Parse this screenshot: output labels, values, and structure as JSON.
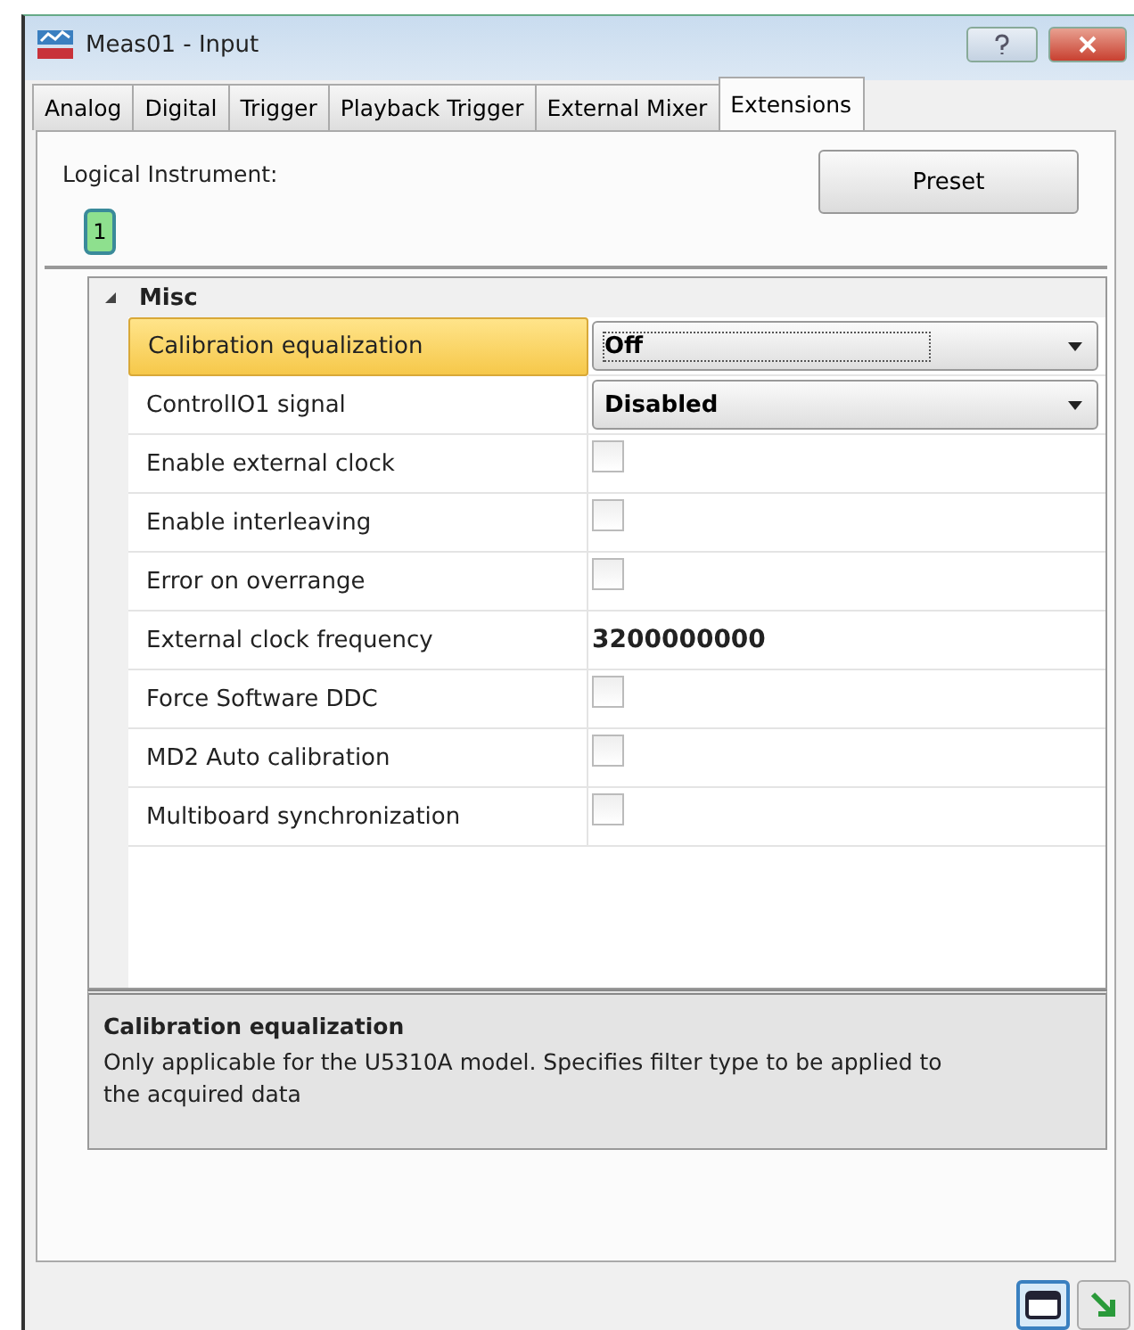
{
  "window": {
    "title": "Meas01 - Input"
  },
  "tabs": [
    {
      "label": "Analog",
      "selected": false
    },
    {
      "label": "Digital",
      "selected": false
    },
    {
      "label": "Trigger",
      "selected": false
    },
    {
      "label": "Playback Trigger",
      "selected": false
    },
    {
      "label": "External Mixer",
      "selected": false
    },
    {
      "label": "Extensions",
      "selected": true
    }
  ],
  "logical_instrument": {
    "label": "Logical Instrument:",
    "instruments": [
      {
        "label": "1",
        "selected": true
      }
    ]
  },
  "preset_button": "Preset",
  "property_grid": {
    "category": {
      "label": "Misc",
      "expanded": true
    },
    "rows": [
      {
        "name": "Calibration equalization",
        "kind": "dropdown",
        "value": "Off",
        "selected": true
      },
      {
        "name": "ControlIO1 signal",
        "kind": "dropdown",
        "value": "Disabled",
        "selected": false
      },
      {
        "name": "Enable external clock",
        "kind": "checkbox",
        "checked": false,
        "selected": false
      },
      {
        "name": "Enable interleaving",
        "kind": "checkbox",
        "checked": false,
        "selected": false
      },
      {
        "name": "Error on overrange",
        "kind": "checkbox",
        "checked": false,
        "selected": false
      },
      {
        "name": "External clock frequency",
        "kind": "text",
        "value": "3200000000",
        "selected": false
      },
      {
        "name": "Force Software DDC",
        "kind": "checkbox",
        "checked": false,
        "selected": false
      },
      {
        "name": "MD2 Auto calibration",
        "kind": "checkbox",
        "checked": false,
        "selected": false
      },
      {
        "name": "Multiboard synchronization",
        "kind": "checkbox",
        "checked": false,
        "selected": false
      }
    ]
  },
  "description": {
    "title": "Calibration equalization",
    "text": "Only applicable for the U5310A model. Specifies filter type to be applied to the acquired data"
  }
}
